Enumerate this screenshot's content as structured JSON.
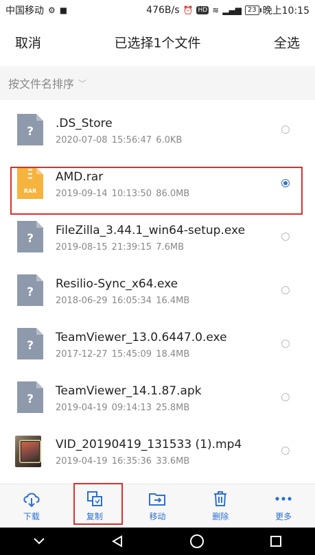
{
  "status": {
    "carrier": "中国移动",
    "speed": "476B/s",
    "battery": "23",
    "time": "晚上10:15"
  },
  "header": {
    "cancel": "取消",
    "title": "已选择1个文件",
    "select_all": "全选"
  },
  "sort": {
    "label": "按文件名排序"
  },
  "files": [
    {
      "name": ".DS_Store",
      "meta": "2020-07-08 15:56:47  6.0KB",
      "type": "unknown",
      "selected": false
    },
    {
      "name": "AMD.rar",
      "meta": "2019-09-14 10:13:50  86.0MB",
      "type": "rar",
      "selected": true
    },
    {
      "name": "FileZilla_3.44.1_win64-setup.exe",
      "meta": "2019-08-15 21:39:15  7.6MB",
      "type": "unknown",
      "selected": false
    },
    {
      "name": "Resilio-Sync_x64.exe",
      "meta": "2018-06-29 16:05:34  16.4MB",
      "type": "unknown",
      "selected": false
    },
    {
      "name": "TeamViewer_13.0.6447.0.exe",
      "meta": "2017-12-27 15:45:09  18.4MB",
      "type": "unknown",
      "selected": false
    },
    {
      "name": "TeamViewer_14.1.87.apk",
      "meta": "2019-04-19 09:14:13  25.8MB",
      "type": "unknown",
      "selected": false
    },
    {
      "name": "VID_20190419_131533 (1).mp4",
      "meta": "2019-04-19 16:35:36  33.6MB",
      "type": "video",
      "selected": false
    }
  ],
  "rar_label": "RAR",
  "toolbar": {
    "download": "下载",
    "copy": "复制",
    "move": "移动",
    "delete": "删除",
    "more": "更多"
  },
  "colors": {
    "accent": "#2d6fd3",
    "highlight": "#d9302c",
    "file_gray": "#8e9aab",
    "rar_orange": "#f6b33d"
  }
}
